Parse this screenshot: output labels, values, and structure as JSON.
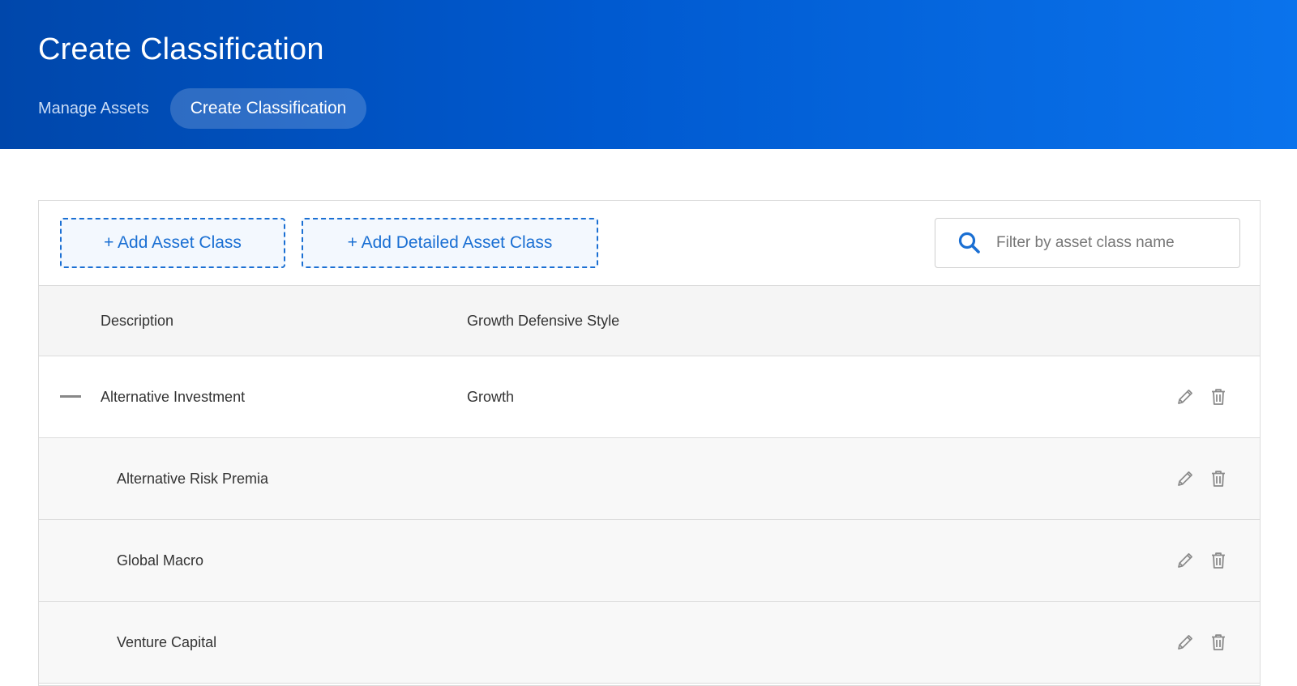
{
  "header": {
    "title": "Create Classification",
    "nav": {
      "manage_assets": "Manage Assets",
      "create_classification": "Create Classification"
    }
  },
  "toolbar": {
    "add_asset_class": "+ Add Asset Class",
    "add_detailed_asset_class": "+ Add Detailed Asset Class",
    "search_placeholder": "Filter by asset class name",
    "search_value": ""
  },
  "table": {
    "columns": {
      "description": "Description",
      "style": "Growth Defensive Style"
    },
    "rows": [
      {
        "description": "Alternative Investment",
        "style": "Growth",
        "level": "parent"
      },
      {
        "description": "Alternative Risk Premia",
        "style": "",
        "level": "child"
      },
      {
        "description": "Global Macro",
        "style": "",
        "level": "child"
      },
      {
        "description": "Venture Capital",
        "style": "",
        "level": "child"
      }
    ]
  },
  "icons": {
    "search": "search-icon",
    "collapse": "minus-icon",
    "edit": "pencil-icon",
    "delete": "trash-icon"
  },
  "colors": {
    "header_start": "#0047ab",
    "header_end": "#0a73ec",
    "accent": "#1a6fd3",
    "icon_gray": "#8a8a8a"
  }
}
